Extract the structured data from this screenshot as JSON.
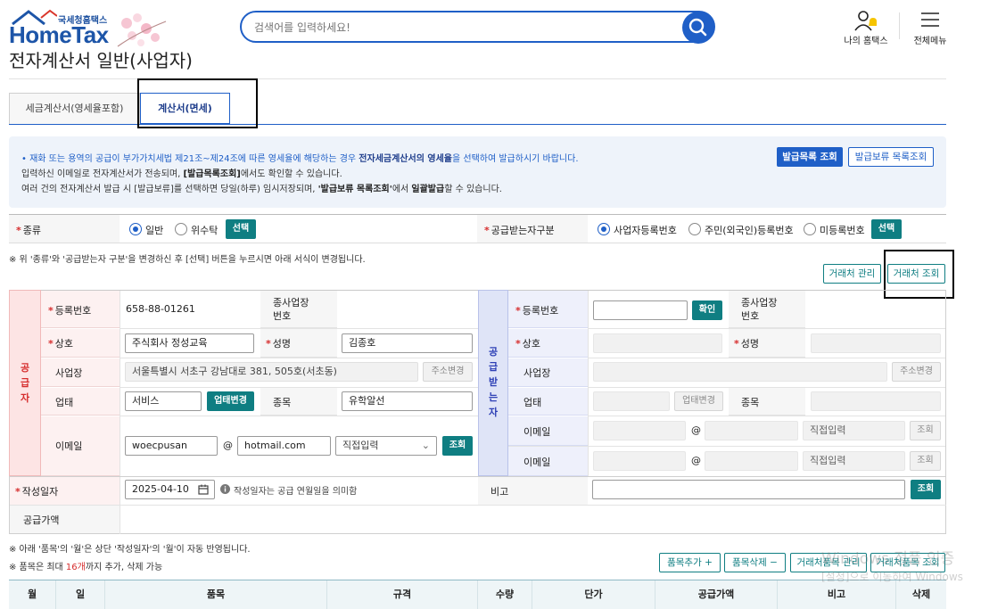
{
  "header": {
    "logo_sub": "국세청홈택스",
    "logo_main": "HomeTax",
    "search_placeholder": "검색어를 입력하세요!",
    "my_hometax": "나의 홈택스",
    "all_menu": "전체메뉴"
  },
  "page_title": "전자계산서 일반(사업자)",
  "tabs": [
    {
      "label": "세금계산서(영세율포함)",
      "active": false
    },
    {
      "label": "계산서(면세)",
      "active": true
    }
  ],
  "info": {
    "line1_pre": "• 재화 또는 용역의 공급이 부가가치세법 제21조~제24조에 따른 영세율에 해당하는 경우 ",
    "line1_bold": "전자세금계산서의 영세율",
    "line1_post": "을 선택하여 발급하시기 바랍니다.",
    "line2_pre": "입력하신 이메일로 전자계산서가 전송되며, ",
    "line2_bold": "[발급목록조회]",
    "line2_post": "에서도 확인할 수 있습니다.",
    "line3_pre": "여러 건의 전자계산서 발급 시 [발급보류]를 선택하면 당일(하루) 임시저장되며, ",
    "line3_bold1": "'발급보류 목록조회'",
    "line3_mid": "에서 ",
    "line3_bold2": "일괄발급",
    "line3_post": "할 수 있습니다.",
    "btn_issue_list": "발급목록 조회",
    "btn_hold_list": "발급보류 목록조회"
  },
  "category": {
    "kind_label": "종류",
    "kind_options": [
      "일반",
      "위수탁"
    ],
    "kind_selected": "일반",
    "select_btn": "선택",
    "receiver_type_label": "공급받는자구분",
    "receiver_options": [
      "사업자등록번호",
      "주민(외국인)등록번호",
      "미등록번호"
    ],
    "receiver_selected": "사업자등록번호",
    "select_btn2": "선택"
  },
  "notice_change": "※ 위 '종류'와 '공급받는자 구분'을 변경하신 후 [선택] 버튼을 누르시면 아래 서식이 변경됩니다.",
  "partner_buttons": {
    "manage": "거래처 관리",
    "search": "거래처 조회"
  },
  "supplier": {
    "side_label": [
      "공",
      "급",
      "자"
    ],
    "reg_no_label": "등록번호",
    "reg_no": "658-88-01261",
    "branch_no_label": "종사업장\n번호",
    "company_label": "상호",
    "company": "주식회사 정성교육",
    "name_label": "성명",
    "name": "김종호",
    "address_label": "사업장",
    "address": "서울특별시 서초구 강남대로 381, 505호(서초동)",
    "address_btn": "주소변경",
    "business_type_label": "업태",
    "business_type": "서비스",
    "business_type_btn": "업태변경",
    "business_item_label": "종목",
    "business_item": "유학알선",
    "email_label": "이메일",
    "email_id": "woecpusan",
    "email_at": "@",
    "email_domain": "hotmail.com",
    "email_select": "직접입력",
    "email_btn": "조회"
  },
  "receiver": {
    "side_label": [
      "공",
      "급",
      "받",
      "는",
      "자"
    ],
    "reg_no_label": "등록번호",
    "confirm_btn": "확인",
    "branch_no_label": "종사업장\n번호",
    "company_label": "상호",
    "name_label": "성명",
    "address_label": "사업장",
    "address_btn": "주소변경",
    "business_type_label": "업태",
    "business_type_btn": "업태변경",
    "business_item_label": "종목",
    "email_label": "이메일",
    "email_at": "@",
    "email_select": "직접입력",
    "email_btn": "조회"
  },
  "write_date": {
    "label": "작성일자",
    "value": "2025-04-10",
    "hint": "작성일자는 공급 연월일을 의미함",
    "remark_label": "비고",
    "remark_btn": "조회"
  },
  "supply_amount_label": "공급가액",
  "notes": {
    "line1": "※ 아래 '품목'의 '월'은 상단 '작성일자'의 '월'이 자동 반영됩니다.",
    "line2_pre": "※ 품목은 최대 ",
    "line2_num": "16개",
    "line2_post": "까지 추가, 삭제 가능"
  },
  "item_buttons": {
    "add": "품목추가 +",
    "delete": "품목삭제 −",
    "manage": "거래처품목 관리",
    "search": "거래처품목 조회"
  },
  "item_table_headers": [
    "월",
    "일",
    "품목",
    "규격",
    "수량",
    "단가",
    "공급가액",
    "비고",
    "삭제"
  ],
  "watermark": {
    "line1": "Windows 정품 인증",
    "line2": "[설정]으로 이동하여 Windows"
  },
  "colors": {
    "brand_blue": "#1f5fc7",
    "teal": "#0f7e82",
    "required_red": "#d62d2d"
  }
}
